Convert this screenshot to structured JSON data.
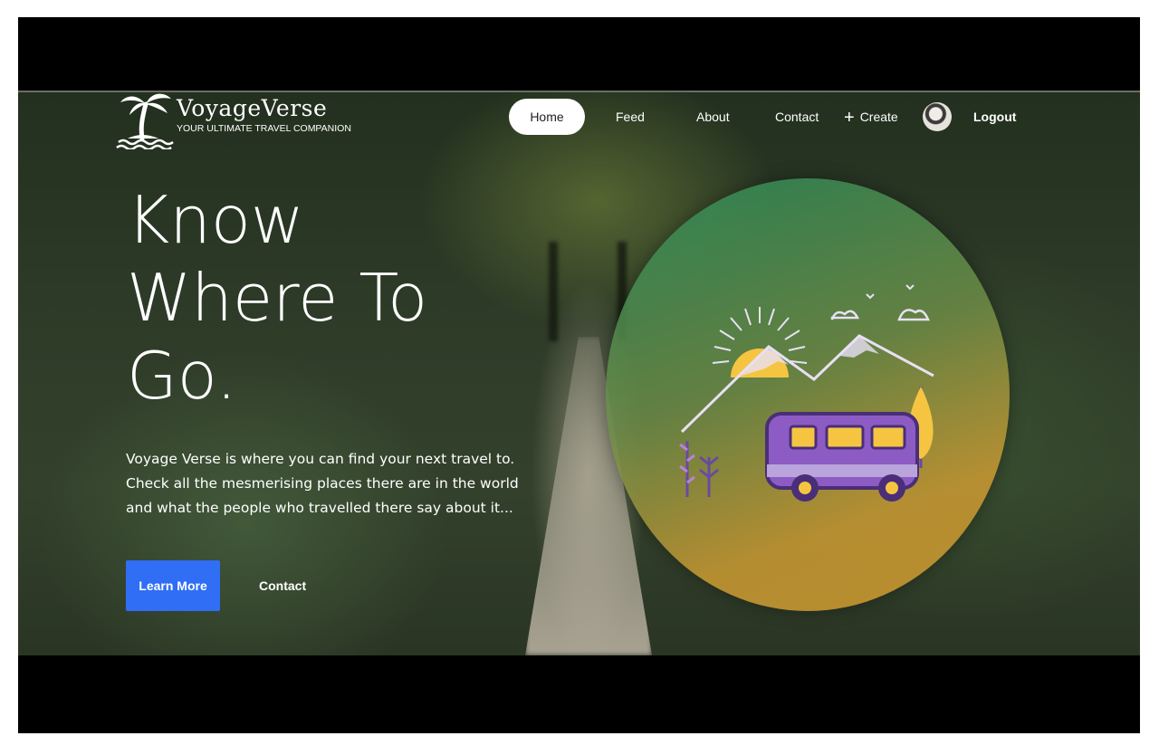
{
  "logo": {
    "title": "VoyageVerse",
    "subtitle": "YOUR ULTIMATE TRAVEL COMPANION"
  },
  "nav": {
    "home": "Home",
    "feed": "Feed",
    "about": "About",
    "contact": "Contact",
    "create": "Create",
    "logout": "Logout"
  },
  "hero": {
    "headline": [
      "Know",
      "Where To",
      "Go."
    ],
    "description": [
      "Voyage Verse is where you can find your next travel to.",
      "Check all the mesmerising places there are in the world",
      "and what the people who travelled there say about it..."
    ],
    "learn_more": "Learn More",
    "contact": "Contact"
  },
  "colors": {
    "primary_button": "#2f6ef5",
    "van": "#8c5cc4",
    "sun": "#f5c542"
  },
  "icons": [
    "palm-tree-logo-icon",
    "plus-icon",
    "avatar",
    "travel-van-illustration"
  ]
}
